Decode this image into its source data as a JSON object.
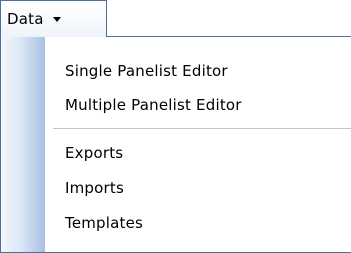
{
  "menu": {
    "title": "Data",
    "items": [
      {
        "label": "Single Panelist Editor"
      },
      {
        "label": "Multiple Panelist Editor"
      },
      {
        "label": "Exports"
      },
      {
        "label": "Imports"
      },
      {
        "label": "Templates"
      }
    ],
    "icons": {
      "dropdown_arrow": "caret-down-icon"
    },
    "colors": {
      "border": "#4c6e9f",
      "gutter_light": "#f4f7fc",
      "gutter_dark": "#a9c0e3",
      "separator": "#bbc6d8"
    }
  }
}
